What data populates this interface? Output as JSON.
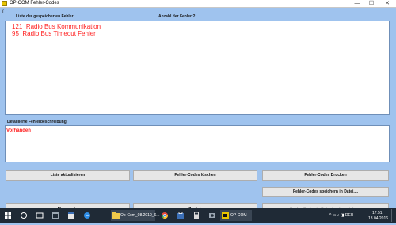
{
  "window": {
    "title": "OP-COM Fehler-Codes"
  },
  "window_controls": {
    "minimize": "—",
    "maximize": "☐",
    "close": "✕"
  },
  "list_section": {
    "label": "Liste der gespeicherten Fehler",
    "count_label": "Anzahl der Fehler:2",
    "corner_mark": "f",
    "faults": [
      {
        "code": "121",
        "text": "Radio Bus Kommunikation"
      },
      {
        "code": "95",
        "text": "Radio Bus Timeout Fehler"
      }
    ]
  },
  "description_section": {
    "label": "Detaillierte Fehlerbeschreibung",
    "text": "Vorhanden"
  },
  "buttons": {
    "refresh": "Liste aktualisieren",
    "clear": "Fehler-Codes löschen",
    "print": "Fehler-Codes Drucken",
    "save_file": "Fehler-Codes speichern in Datei....",
    "measured": "Messwerte",
    "back": "Zurück",
    "save_db": "Fehler-Codes in Datenbank speichern"
  },
  "taskbar": {
    "items": [
      {
        "icon": "windows-start-icon",
        "label": ""
      },
      {
        "icon": "cortana-icon",
        "label": ""
      },
      {
        "icon": "task-view-icon",
        "label": ""
      },
      {
        "icon": "calendar-icon",
        "label": ""
      },
      {
        "icon": "edge-icon",
        "label": ""
      },
      {
        "icon": "file-explorer-icon",
        "label": "Op-Com_08.2010_6..."
      },
      {
        "icon": "chrome-icon",
        "label": ""
      },
      {
        "icon": "store-icon",
        "label": ""
      },
      {
        "icon": "calculator-icon",
        "label": ""
      },
      {
        "icon": "camera-icon",
        "label": ""
      },
      {
        "icon": "opcom-icon",
        "label": "OP-COM"
      }
    ],
    "tray_text": "^ ▭ ♪ ◨ DEU",
    "time": "17:51",
    "date": "13.04.2016"
  },
  "colors": {
    "background": "#9fc3ee",
    "fault_text": "#ff1f1f",
    "taskbar": "#1f2a36"
  }
}
